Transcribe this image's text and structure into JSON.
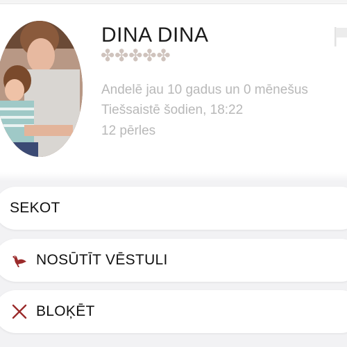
{
  "profile": {
    "name": "DINA DINA",
    "stars": "✤✤✤✤✤",
    "member_since": "Andelē jau 10 gadus un 0 mēnešus",
    "last_online": "Tiešsaistē šodien, 18:22",
    "pearls": "12 pērles"
  },
  "actions": {
    "follow_label": "SEKOT",
    "message_label": "NOSŪTĪT VĒSTULI",
    "block_label": "BLOĶĒT"
  },
  "colors": {
    "accent": "#9b2b2b",
    "muted_text": "#b8b8b8",
    "stars": "#cfc3bd"
  },
  "icons": {
    "flag": "flag-icon",
    "message": "pigeon-icon",
    "block": "close-icon"
  }
}
